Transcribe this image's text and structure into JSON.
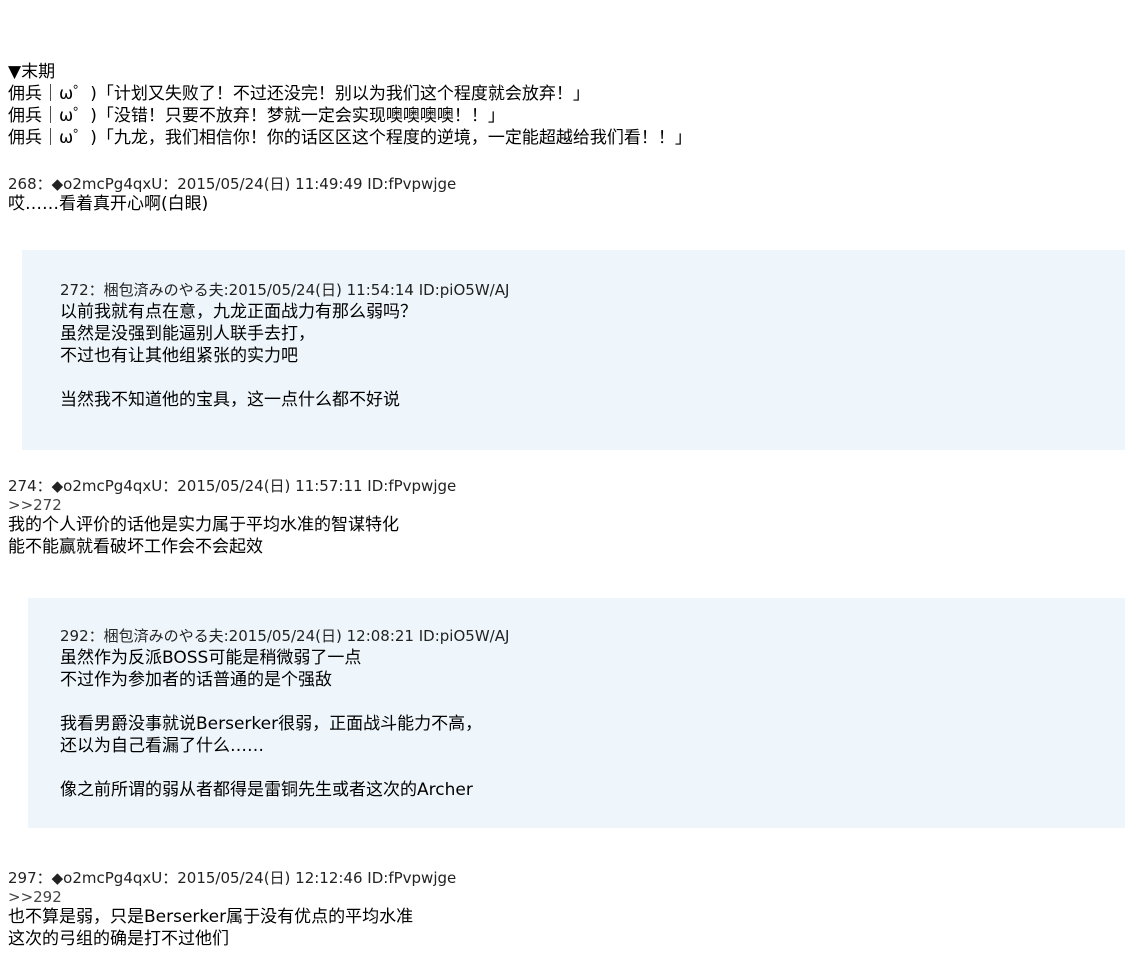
{
  "top": {
    "heading": "▼末期",
    "lines": [
      "佣兵｜ω゜)「计划又失败了！不过还没完！别以为我们这个程度就会放弃！」",
      "佣兵｜ω゜)「没错！只要不放弃！梦就一定会实现噢噢噢噢！！」",
      "佣兵｜ω゜)「九龙，我们相信你！你的话区区这个程度的逆境，一定能超越给我们看！！」"
    ]
  },
  "p268": {
    "header": "268：◆o2mcPg4qxU：2015/05/24(日) 11:49:49 ID:fPvpwjge",
    "lines": [
      "哎……看着真开心啊(白眼)"
    ]
  },
  "p272": {
    "header": "272：梱包済みのやる夫:2015/05/24(日) 11:54:14 ID:piO5W/AJ",
    "lines": [
      "以前我就有点在意，九龙正面战力有那么弱吗？",
      "虽然是没强到能逼别人联手去打，",
      "不过也有让其他组紧张的实力吧",
      "当然我不知道他的宝具，这一点什么都不好说"
    ]
  },
  "p274": {
    "header": "274：◆o2mcPg4qxU：2015/05/24(日) 11:57:11 ID:fPvpwjge",
    "ref": ">>272",
    "lines": [
      "我的个人评价的话他是实力属于平均水准的智谋特化",
      "能不能赢就看破坏工作会不会起效"
    ]
  },
  "p292": {
    "header": "292：梱包済みのやる夫:2015/05/24(日) 12:08:21 ID:piO5W/AJ",
    "lines": [
      "虽然作为反派BOSS可能是稍微弱了一点",
      "不过作为参加者的话普通的是个强敌",
      "我看男爵没事就说Berserker很弱，正面战斗能力不高，",
      "还以为自己看漏了什么……",
      "像之前所谓的弱从者都得是雷铜先生或者这次的Archer"
    ]
  },
  "p297": {
    "header": "297：◆o2mcPg4qxU：2015/05/24(日) 12:12:46 ID:fPvpwjge",
    "ref": ">>292",
    "lines": [
      "也不算是弱，只是Berserker属于没有优点的平均水准",
      "这次的弓组的确是打不过他们"
    ]
  },
  "colors": {
    "quote_bg": "#eef6fb"
  }
}
